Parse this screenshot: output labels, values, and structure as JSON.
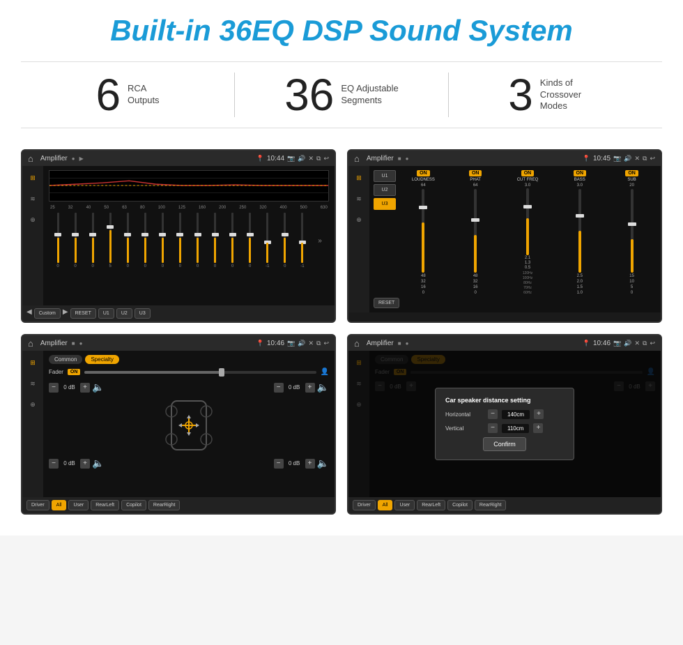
{
  "page": {
    "title": "Built-in 36EQ DSP Sound System"
  },
  "stats": [
    {
      "number": "6",
      "label": "RCA\nOutputs"
    },
    {
      "number": "36",
      "label": "EQ Adjustable\nSegments"
    },
    {
      "number": "3",
      "label": "Kinds of\nCrossover Modes"
    }
  ],
  "screens": [
    {
      "id": "eq-screen",
      "title": "Amplifier",
      "time": "10:44",
      "type": "eq"
    },
    {
      "id": "crossover-screen",
      "title": "Amplifier",
      "time": "10:45",
      "type": "crossover"
    },
    {
      "id": "fader-screen",
      "title": "Amplifier",
      "time": "10:46",
      "type": "fader"
    },
    {
      "id": "distance-screen",
      "title": "Amplifier",
      "time": "10:46",
      "type": "distance"
    }
  ],
  "eq": {
    "bands": [
      "25",
      "32",
      "40",
      "50",
      "63",
      "80",
      "100",
      "125",
      "160",
      "200",
      "250",
      "320",
      "400",
      "500",
      "630"
    ],
    "values": [
      "0",
      "0",
      "0",
      "5",
      "0",
      "0",
      "0",
      "0",
      "0",
      "0",
      "0",
      "0",
      "-1",
      "0",
      "-1"
    ],
    "heights": [
      50,
      50,
      50,
      65,
      50,
      50,
      50,
      50,
      50,
      50,
      50,
      50,
      42,
      50,
      42
    ],
    "mode": "Custom",
    "presets": [
      "RESET",
      "U1",
      "U2",
      "U3"
    ]
  },
  "crossover": {
    "presets": [
      "U1",
      "U2",
      "U3"
    ],
    "channels": [
      {
        "name": "LOUDNESS",
        "on": true
      },
      {
        "name": "PHAT",
        "on": true
      },
      {
        "name": "CUT FREQ",
        "on": true
      },
      {
        "name": "BASS",
        "on": true
      },
      {
        "name": "SUB",
        "on": true
      }
    ],
    "reset": "RESET"
  },
  "fader": {
    "tabs": [
      "Common",
      "Specialty"
    ],
    "activeTab": "Specialty",
    "faderLabel": "Fader",
    "faderOn": "ON",
    "channels": [
      {
        "label": "0 dB"
      },
      {
        "label": "0 dB"
      },
      {
        "label": "0 dB"
      },
      {
        "label": "0 dB"
      }
    ],
    "buttons": [
      "Driver",
      "RearLeft",
      "All",
      "User",
      "Copilot",
      "RearRight"
    ]
  },
  "distance": {
    "tabs": [
      "Common",
      "Specialty"
    ],
    "dialog": {
      "title": "Car speaker distance setting",
      "horizontal_label": "Horizontal",
      "horizontal_value": "140cm",
      "vertical_label": "Vertical",
      "vertical_value": "110cm",
      "confirm": "Confirm"
    },
    "channels": [
      {
        "label": "0 dB"
      },
      {
        "label": "0 dB"
      }
    ],
    "buttons": [
      "Driver",
      "RearLeft",
      "All",
      "User",
      "Copilot",
      "RearRight"
    ]
  },
  "icons": {
    "home": "⌂",
    "back": "↩",
    "location_pin": "📍",
    "camera": "📷",
    "volume": "🔊",
    "x": "✕",
    "clone": "⧉",
    "settings": "⚙",
    "equalizer": "≡",
    "waveform": "≋",
    "speaker": "⊕",
    "arrow_up": "▲",
    "arrow_down": "▼",
    "person": "👤"
  },
  "colors": {
    "accent": "#f0a500",
    "bg_dark": "#111111",
    "bg_medium": "#1e1e1e",
    "bg_bar": "#2a2a2a",
    "text_light": "#cccccc",
    "brand_blue": "#1a9bd7"
  }
}
